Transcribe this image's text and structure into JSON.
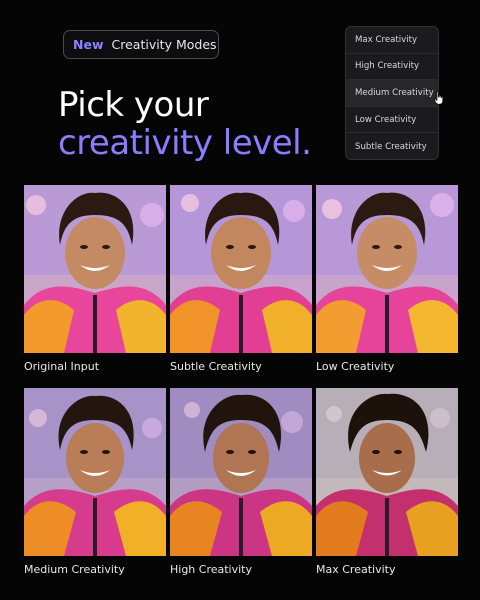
{
  "badge": {
    "tag": "New",
    "text": "Creativity Modes"
  },
  "headline": {
    "line1": "Pick your",
    "line2": "creativity level."
  },
  "menu": {
    "items": [
      "Max Creativity",
      "High Creativity",
      "Medium Creativity",
      "Low Creativity",
      "Subtle Creativity"
    ],
    "hovered": "Medium Creativity"
  },
  "grid": {
    "captions": [
      "Original Input",
      "Subtle Creativity",
      "Low Creativity",
      "Medium Creativity",
      "High Creativity",
      "Max Creativity"
    ]
  },
  "colors": {
    "accent": "#8a7dff",
    "background": "#050505",
    "menu": "#1b1b1f"
  }
}
